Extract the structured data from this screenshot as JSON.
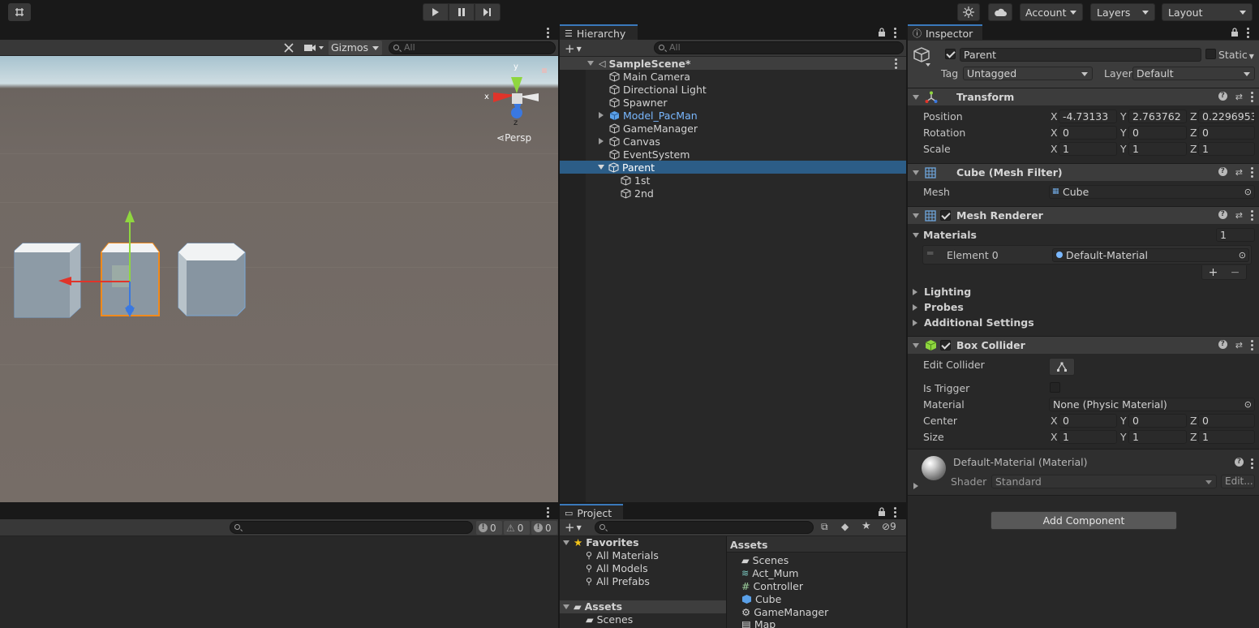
{
  "colors": {
    "accent": "#3a79bb",
    "selection": "#2c5d87",
    "prefab_blue": "#7ab8ff",
    "panel": "#282828",
    "header": "#3c3c3c"
  },
  "toolbar": {
    "account": "Account",
    "layers": "Layers",
    "layout": "Layout"
  },
  "scene": {
    "gizmos_label": "Gizmos",
    "search_placeholder": "All",
    "persp_label": "Persp",
    "axis_y": "y",
    "axis_x": "x",
    "axis_z": "z"
  },
  "console": {
    "search_placeholder": "",
    "info_count": "0",
    "warn_count": "0",
    "error_count": "0"
  },
  "hierarchy": {
    "tab_label": "Hierarchy",
    "search_placeholder": "All",
    "scene_name": "SampleScene*",
    "items": [
      {
        "label": "Main Camera"
      },
      {
        "label": "Directional Light"
      },
      {
        "label": "Spawner"
      },
      {
        "label": "Model_PacMan"
      },
      {
        "label": "GameManager"
      },
      {
        "label": "Canvas"
      },
      {
        "label": "EventSystem"
      },
      {
        "label": "Parent"
      },
      {
        "label": "1st"
      },
      {
        "label": "2nd"
      }
    ]
  },
  "project": {
    "tab_label": "Project",
    "hidden_count": "9",
    "favorites_label": "Favorites",
    "favorites": [
      "All Materials",
      "All Models",
      "All Prefabs"
    ],
    "assets_tree_label": "Assets",
    "assets_tree_children": [
      "Scenes"
    ],
    "assets_header": "Assets",
    "assets": [
      "Scenes",
      "Act_Mum",
      "Controller",
      "Cube",
      "GameManager",
      "Map"
    ]
  },
  "inspector": {
    "tab_label": "Inspector",
    "object_name": "Parent",
    "static_label": "Static",
    "tag_label": "Tag",
    "tag_value": "Untagged",
    "layer_label": "Layer",
    "layer_value": "Default",
    "transform": {
      "title": "Transform",
      "position_label": "Position",
      "rotation_label": "Rotation",
      "scale_label": "Scale",
      "position": {
        "x": "-4.73133",
        "y": "2.763762",
        "z": "0.2296953"
      },
      "rotation": {
        "x": "0",
        "y": "0",
        "z": "0"
      },
      "scale": {
        "x": "1",
        "y": "1",
        "z": "1"
      }
    },
    "mesh_filter": {
      "title": "Cube (Mesh Filter)",
      "mesh_label": "Mesh",
      "mesh_value": "Cube"
    },
    "mesh_renderer": {
      "title": "Mesh Renderer",
      "materials_label": "Materials",
      "materials_count": "1",
      "element_label": "Element 0",
      "element_value": "Default-Material",
      "lighting": "Lighting",
      "probes": "Probes",
      "additional": "Additional Settings"
    },
    "box_collider": {
      "title": "Box Collider",
      "edit_label": "Edit Collider",
      "trigger_label": "Is Trigger",
      "material_label": "Material",
      "material_value": "None (Physic Material)",
      "center_label": "Center",
      "size_label": "Size",
      "center": {
        "x": "0",
        "y": "0",
        "z": "0"
      },
      "size": {
        "x": "1",
        "y": "1",
        "z": "1"
      }
    },
    "material": {
      "title": "Default-Material (Material)",
      "shader_label": "Shader",
      "shader_value": "Standard",
      "edit_label": "Edit..."
    },
    "add_component": "Add Component",
    "axis_x": "X",
    "axis_y": "Y",
    "axis_z": "Z"
  }
}
